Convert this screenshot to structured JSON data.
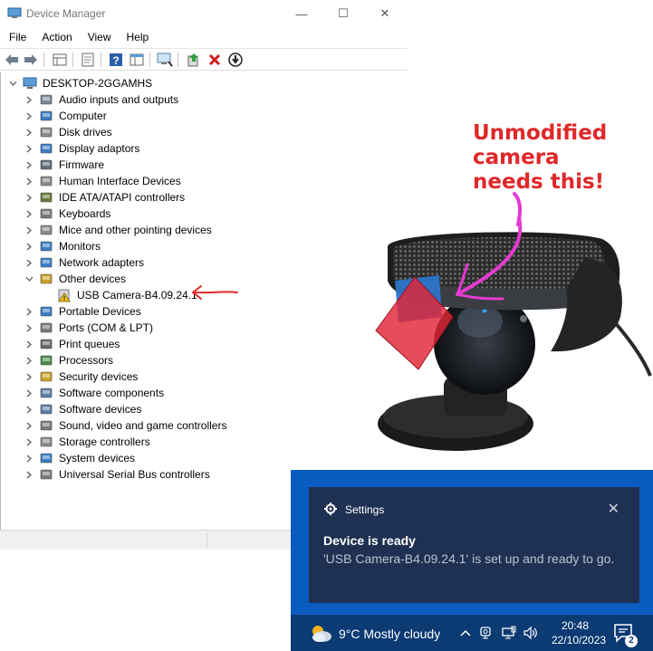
{
  "window": {
    "title": "Device Manager",
    "minimize_glyph": "—",
    "maximize_glyph": "☐",
    "close_glyph": "✕"
  },
  "menu": [
    "File",
    "Action",
    "View",
    "Help"
  ],
  "toolbar_icons": [
    "back-arrow-icon",
    "forward-arrow-icon",
    "properties-grid-icon",
    "update-driver-icon",
    "help-icon",
    "console-tree-icon",
    "scan-hardware-icon",
    "add-driver-icon",
    "uninstall-x-icon",
    "download-circle-icon"
  ],
  "tree": {
    "root": "DESKTOP-2GGAMHS",
    "categories": [
      "Audio inputs and outputs",
      "Computer",
      "Disk drives",
      "Display adaptors",
      "Firmware",
      "Human Interface Devices",
      "IDE ATA/ATAPI controllers",
      "Keyboards",
      "Mice and other pointing devices",
      "Monitors",
      "Network adapters",
      "Other devices",
      "USB Camera-B4.09.24.1",
      "Portable Devices",
      "Ports (COM & LPT)",
      "Print queues",
      "Processors",
      "Security devices",
      "Software components",
      "Software devices",
      "Sound, video and game controllers",
      "Storage controllers",
      "System devices",
      "Universal Serial Bus controllers"
    ],
    "expanded_category": "Other devices",
    "child_device": "USB Camera-B4.09.24.1"
  },
  "annotation": {
    "lines": [
      "Unmodified",
      "camera",
      "needs this!"
    ],
    "color": "#e0282a",
    "arrow_color": "#e0282a",
    "pink_arrow_color": "#e53bd0"
  },
  "notification": {
    "app_name": "Settings",
    "close_glyph": "✕",
    "title": "Device is ready",
    "body": "'USB Camera-B4.09.24.1' is set up and ready to go."
  },
  "taskbar": {
    "weather": "9°C  Mostly cloudy",
    "time": "20:48",
    "date": "22/10/2023",
    "notification_count": "2"
  },
  "colors": {
    "notification_bg": "#0a5cc0",
    "notification_card": "#1f3152",
    "taskbar_bg": "#0c3a72",
    "annotation_red": "#e0282a"
  }
}
